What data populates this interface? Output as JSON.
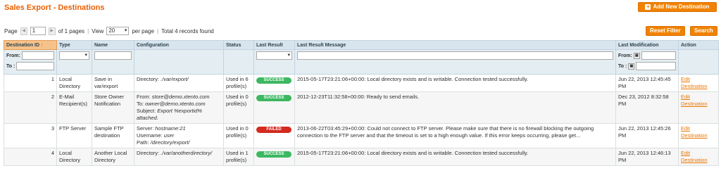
{
  "header": {
    "title": "Sales Export - Destinations",
    "add_button": "Add New Destination"
  },
  "pager": {
    "page_label": "Page",
    "page_value": "1",
    "of_pages": "of 1 pages",
    "view_label": "View",
    "view_value": "20",
    "per_page": "per page",
    "total": "Total 4 records found"
  },
  "actions": {
    "reset": "Reset Filter",
    "search": "Search"
  },
  "columns": [
    "Destination ID",
    "Type",
    "Name",
    "Configuration",
    "Status",
    "Last Result",
    "Last Result Message",
    "Last Modification",
    "Action"
  ],
  "filters": {
    "from": "From:",
    "to": "To :"
  },
  "rows": [
    {
      "id": "1",
      "type": "Local Directory",
      "name": "Save in var/export",
      "config": [
        {
          "label": "Directory: ",
          "value": "./var/export/"
        }
      ],
      "status": "Used in 6 profile(s)",
      "result": "SUCCESS",
      "message": "2015-05-17T23:21:06+00:00: Local directory exists and is writable. Connection tested successfully.",
      "modified": "Jun 22, 2013 12:45:45 PM",
      "action": "Edit Destination"
    },
    {
      "id": "2",
      "type": "E-Mail Recipient(s)",
      "name": "Store Owner Notification",
      "config": [
        {
          "label": "From: ",
          "value": "store@demo.xtento.com"
        },
        {
          "label": "To: ",
          "value": "owner@demo.xtento.com"
        },
        {
          "label": "Subject: ",
          "value": "Export %exportid% attached."
        }
      ],
      "status": "Used in 0 profile(s)",
      "result": "SUCCESS",
      "message": "2012-12-23T11:32:58+00:00: Ready to send emails.",
      "modified": "Dec 23, 2012 8:32:58 PM",
      "action": "Edit Destination"
    },
    {
      "id": "3",
      "type": "FTP Server",
      "name": "Sample FTP destination",
      "config": [
        {
          "label": "Server: ",
          "value": "hostname:21"
        },
        {
          "label": "Username: ",
          "value": "user"
        },
        {
          "label": "Path: ",
          "value": "/directory/export/"
        }
      ],
      "status": "Used in 0 profile(s)",
      "result": "FAILED",
      "message": "2013-06-22T03:45:29+00:00: Could not connect to FTP server. Please make sure that there is no firewall blocking the outgoing connection to the FTP server and that the timeout is set to a high enough value. If this error keeps occurring, please get...",
      "modified": "Jun 22, 2013 12:45:26 PM",
      "action": "Edit Destination"
    },
    {
      "id": "4",
      "type": "Local Directory",
      "name": "Another Local Directory",
      "config": [
        {
          "label": "Directory: ",
          "value": "./var/anotherdirectory/"
        }
      ],
      "status": "Used in 1 profile(s)",
      "result": "SUCCESS",
      "message": "2015-05-17T23:21:06+00:00: Local directory exists and is writable. Connection tested successfully.",
      "modified": "Jun 22, 2013 12:46:13 PM",
      "action": "Edit Destination"
    }
  ],
  "colors": {
    "accent": "#eb5e00",
    "button": "#f18200",
    "success": "#3cb861",
    "failed": "#d42a1f"
  }
}
